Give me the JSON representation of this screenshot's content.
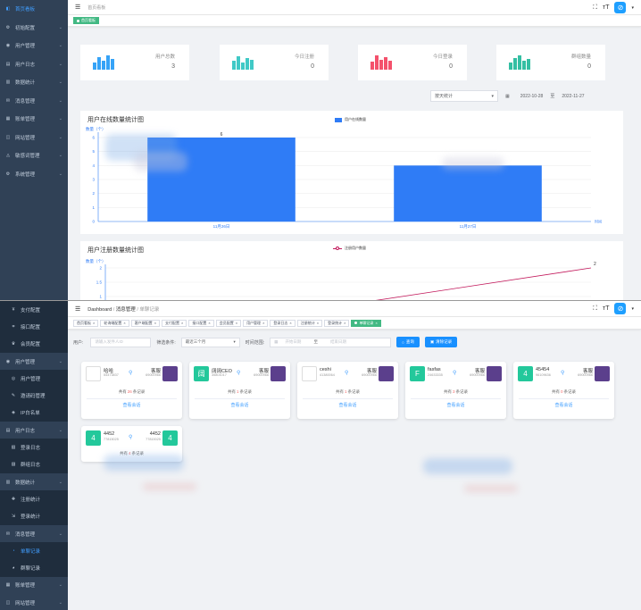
{
  "top": {
    "sidebar": [
      {
        "label": "首页看板",
        "icon": "dashboard-icon",
        "active": true
      },
      {
        "label": "初始配置",
        "icon": "setting-icon"
      },
      {
        "label": "用户管理",
        "icon": "user-icon"
      },
      {
        "label": "用户日志",
        "icon": "user-log-icon"
      },
      {
        "label": "数据统计",
        "icon": "chart-icon"
      },
      {
        "label": "消息管理",
        "icon": "message-icon"
      },
      {
        "label": "账单管理",
        "icon": "bill-icon"
      },
      {
        "label": "网站管理",
        "icon": "site-icon"
      },
      {
        "label": "敏感词管理",
        "icon": "filter-icon"
      },
      {
        "label": "系统管理",
        "icon": "system-icon"
      }
    ],
    "breadcrumb": "首页看板",
    "tags": [
      {
        "label": "首页看板",
        "active": true
      }
    ],
    "stats": [
      {
        "label": "用户总数",
        "value": "3",
        "color": "#36a3f7"
      },
      {
        "label": "今日注册",
        "value": "0",
        "color": "#40c9c6"
      },
      {
        "label": "今日登录",
        "value": "0",
        "color": "#f4516c"
      },
      {
        "label": "群组数量",
        "value": "0",
        "color": "#34bfa3"
      }
    ],
    "filter": {
      "select": "按天统计",
      "start": "2022-10-28",
      "sep": "至",
      "end": "2022-11-27"
    },
    "online_chart": {
      "title": "用户在线数量统计图",
      "legend": "用户在线数量",
      "ylabel": "数量（个）",
      "xlabel": "时间",
      "color": "#2f7cf6"
    },
    "register_chart": {
      "title": "用户注册数量统计图",
      "legend": "注册用户数量",
      "ylabel": "数量（个）",
      "color": "#c2185b"
    }
  },
  "chart_data": [
    {
      "type": "bar",
      "title": "用户在线数量统计图",
      "ylabel": "数量（个）",
      "xlabel": "时间",
      "categories": [
        "11月26日",
        "11月27日"
      ],
      "series": [
        {
          "name": "用户在线数量",
          "values": [
            6,
            4
          ]
        }
      ],
      "ylim": [
        0,
        6
      ],
      "yticks": [
        "0",
        "1",
        "2",
        "3",
        "4",
        "5",
        "6"
      ],
      "value_labels": [
        "6",
        ""
      ],
      "grid": true,
      "legend": "top"
    },
    {
      "type": "line",
      "title": "用户注册数量统计图",
      "ylabel": "数量（个）",
      "series": [
        {
          "name": "注册用户数量",
          "values": [
            0,
            2
          ]
        }
      ],
      "ylim": [
        1,
        2
      ],
      "yticks": [
        "2",
        "1.5",
        "1"
      ],
      "end_label": "2",
      "grid": true,
      "legend": "top"
    }
  ],
  "bottom": {
    "sidebar": [
      {
        "label": "支付配置",
        "icon": "pay-icon",
        "sub": true
      },
      {
        "label": "接口配置",
        "icon": "api-icon",
        "sub": true
      },
      {
        "label": "会员配置",
        "icon": "member-icon",
        "sub": true
      },
      {
        "label": "用户管理",
        "icon": "user-icon"
      },
      {
        "label": "用户管理",
        "icon": "user-sub-icon",
        "sub": true
      },
      {
        "label": "邀请码管理",
        "icon": "invite-icon",
        "sub": true
      },
      {
        "label": "IP白名单",
        "icon": "ip-icon",
        "sub": true
      },
      {
        "label": "用户日志",
        "icon": "user-log-icon"
      },
      {
        "label": "登录日志",
        "icon": "login-log-icon",
        "sub": true
      },
      {
        "label": "群组日志",
        "icon": "group-log-icon",
        "sub": true
      },
      {
        "label": "数据统计",
        "icon": "chart-icon"
      },
      {
        "label": "注册统计",
        "icon": "register-icon",
        "sub": true
      },
      {
        "label": "登录统计",
        "icon": "login-stat-icon",
        "sub": true
      },
      {
        "label": "消息管理",
        "icon": "message-icon"
      },
      {
        "label": "单聊记录",
        "icon": "chat-icon",
        "sub": true,
        "active": true
      },
      {
        "label": "群聊记录",
        "icon": "group-chat-icon",
        "sub": true
      },
      {
        "label": "账单管理",
        "icon": "bill-icon"
      },
      {
        "label": "网站管理",
        "icon": "site-icon"
      }
    ],
    "breadcrumb": {
      "home": "Dashboard",
      "sep1": "/",
      "parent": "消息管理",
      "sep2": "/",
      "current": "单聊记录"
    },
    "tags": [
      {
        "label": "首页看板"
      },
      {
        "label": "轮询端配置"
      },
      {
        "label": "客户端配置"
      },
      {
        "label": "支付配置"
      },
      {
        "label": "接口配置"
      },
      {
        "label": "会员配置"
      },
      {
        "label": "用户管理"
      },
      {
        "label": "登录日志"
      },
      {
        "label": "注册统计"
      },
      {
        "label": "登录统计"
      },
      {
        "label": "单聊记录",
        "active": true
      }
    ],
    "form": {
      "user_label": "用户:",
      "user_placeholder": "请输入发件人ID",
      "filter_label": "筛选条件:",
      "filter_value": "最近三个月",
      "time_label": "时间范围:",
      "start_placeholder": "开始日期",
      "time_sep": "至",
      "end_placeholder": "结束日期",
      "search_btn": "查询",
      "clear_btn": "清除记录"
    },
    "sessions": [
      {
        "name1": "哈哈",
        "id1": "54473837",
        "name2": "客服",
        "id2": "69000966",
        "count_pre": "共有",
        "count": "26",
        "count_post": "条记录",
        "view": "查看会话",
        "a1_color": "#fff",
        "a1_text": "",
        "a2_color": "#5b3f8c"
      },
      {
        "name1": "阔阔CEO",
        "id1": "35801017",
        "name2": "客服",
        "id2": "69000966",
        "count_pre": "共有",
        "count": "1",
        "count_post": "条记录",
        "view": "查看会话",
        "a1_color": "#23c89b",
        "a1_text": "阔",
        "a2_color": "#5b3f8c"
      },
      {
        "name1": "ceshi",
        "id1": "41380064",
        "name2": "客服",
        "id2": "69000966",
        "count_pre": "共有",
        "count": "1",
        "count_post": "条记录",
        "view": "查看会话",
        "a1_color": "#fff",
        "a1_text": "",
        "a2_color": "#5b3f8c"
      },
      {
        "name1": "fasfas",
        "id1": "24633335",
        "name2": "客服",
        "id2": "69000966",
        "count_pre": "共有",
        "count": "3",
        "count_post": "条记录",
        "view": "查看会话",
        "a1_color": "#23c89b",
        "a1_text": "F",
        "a2_color": "#5b3f8c"
      },
      {
        "name1": "45454",
        "id1": "96109636",
        "name2": "客服",
        "id2": "69000966",
        "count_pre": "共有",
        "count": "0",
        "count_post": "条记录",
        "view": "查看会话",
        "a1_color": "#23c89b",
        "a1_text": "4",
        "a2_color": "#5b3f8c"
      },
      {
        "name1": "4452",
        "id1": "77815025",
        "name2": "4452",
        "id2": "77815025",
        "count_pre": "共有",
        "count": "4",
        "count_post": "条记录",
        "view": "",
        "a1_color": "#23c89b",
        "a1_text": "4",
        "a2_color": "#23c89b",
        "a2_text": "4"
      }
    ]
  }
}
